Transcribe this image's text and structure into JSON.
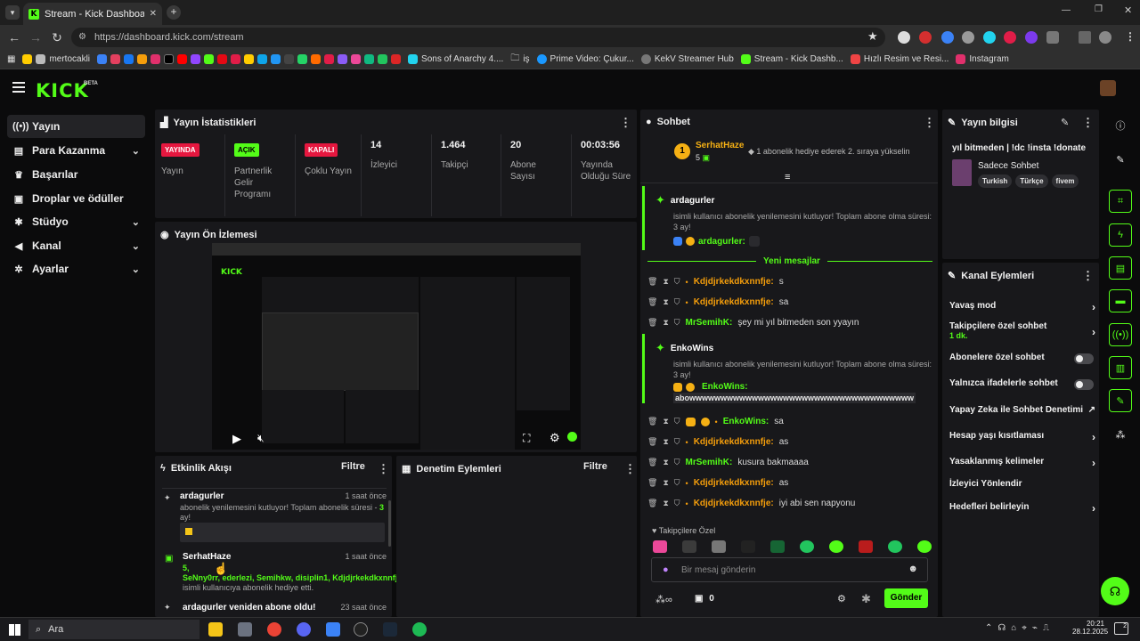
{
  "browser": {
    "tab_title": "Stream - Kick Dashboard",
    "url": "https://dashboard.kick.com/stream",
    "bookmarks": [
      "mertocakli",
      "Sons of Anarchy 4....",
      "iş",
      "Prime Video: Çukur...",
      "KekV Streamer Hub",
      "Stream - Kick Dashb...",
      "Hızlı Resim ve Resi...",
      "Instagram"
    ]
  },
  "header": {
    "logo": "KICK",
    "beta": "BETA"
  },
  "sidebar": {
    "items": [
      {
        "label": "Yayın",
        "icon": "live-icon"
      },
      {
        "label": "Para Kazanma",
        "icon": "money-icon"
      },
      {
        "label": "Başarılar",
        "icon": "trophy-icon"
      },
      {
        "label": "Droplar ve ödüller",
        "icon": "gift-icon"
      },
      {
        "label": "Stüdyo",
        "icon": "gear-icon"
      },
      {
        "label": "Kanal",
        "icon": "megaphone-icon"
      },
      {
        "label": "Ayarlar",
        "icon": "settings-icon"
      }
    ]
  },
  "stats": {
    "title": "Yayın İstatistikleri",
    "cols": [
      {
        "badge": "YAYINDA",
        "label": "Yayın"
      },
      {
        "badge": "AÇIK",
        "label": "Partnerlik Gelir Programı"
      },
      {
        "badge": "KAPALI",
        "label": "Çoklu Yayın"
      },
      {
        "value": "14",
        "label": "İzleyici"
      },
      {
        "value": "1.464",
        "label": "Takipçi"
      },
      {
        "value": "20",
        "label": "Abone Sayısı"
      },
      {
        "value": "00:03:56",
        "label": "Yayında Olduğu Süre"
      }
    ]
  },
  "preview": {
    "title": "Yayın Ön İzlemesi"
  },
  "activity": {
    "title": "Etkinlik Akışı",
    "filter": "Filtre",
    "items": [
      {
        "user": "ardagurler",
        "time": "1 saat önce",
        "text": "abonelik yenilemesini kutluyor! Toplam abonelik süresi -",
        "num": "3",
        "extra": "ay!"
      },
      {
        "user": "SerhatHaze",
        "time": "1 saat önce",
        "count": "5,",
        "names": "SeNny0rr, ederlezi, Semihkw, disiplin1, Kdjdjrkekdkxnnfje",
        "text": "isimli kullanıcıya abonelik hediye etti."
      },
      {
        "user": "ardagurler veniden abone oldu!",
        "time": "23 saat önce"
      }
    ]
  },
  "moderation": {
    "title": "Denetim Eylemleri",
    "filter": "Filtre"
  },
  "chat": {
    "title": "Sohbet",
    "top_user": "SerhatHaze",
    "top_count": "5",
    "top_rank": "1",
    "top_msg": "1 abonelik hediye ederek 2. sıraya yükselin",
    "new_messages": "Yeni mesajlar",
    "sub1": {
      "user": "ardagurler",
      "text": "isimli kullanıcı abonelik yenilemesini kutluyor! Toplam abone olma süresi: 3 ay!",
      "msg_user": "ardagurler:"
    },
    "sub2": {
      "user": "EnkoWins",
      "text": "isimli kullanıcı abonelik yenilemesini kutluyor! Toplam abone olma süresi: 3 ay!",
      "msg_user": "EnkoWins:",
      "msg": "abowwwwwwwwwwwwwwwwwwwwwwwwwwwwwwwwwwww"
    },
    "messages": [
      {
        "user": "Kdjdjrkekdkxnnfje:",
        "text": "s",
        "color": "o"
      },
      {
        "user": "Kdjdjrkekdkxnnfje:",
        "text": "sa",
        "color": "o"
      },
      {
        "user": "MrSemihK:",
        "text": "şey mi yıl bitmeden son yyayın",
        "color": "g"
      },
      {
        "user": "EnkoWins:",
        "text": "sa",
        "color": "g"
      },
      {
        "user": "Kdjdjrkekdkxnnfje:",
        "text": "as",
        "color": "o"
      },
      {
        "user": "MrSemihK:",
        "text": "kusura bakmaaaa",
        "color": "g"
      },
      {
        "user": "Kdjdjrkekdkxnnfje:",
        "text": "as",
        "color": "o"
      },
      {
        "user": "Kdjdjrkekdkxnnfje:",
        "text": "iyi abi sen napyonu",
        "color": "o"
      }
    ],
    "followers_only": "Takipçilere Özel",
    "input_placeholder": "Bir mesaj gönderin",
    "points": "0",
    "send": "Gönder"
  },
  "stream_info": {
    "title": "Yayın bilgisi",
    "stream_title": "yıl bitmeden | !dc !insta !donate",
    "category": "Sadece Sohbet",
    "tags": [
      "Turkish",
      "Türkçe",
      "fivem"
    ]
  },
  "channel_actions": {
    "title": "Kanal Eylemleri",
    "items": [
      {
        "label": "Yavaş mod",
        "type": "chevron"
      },
      {
        "label": "Takipçilere özel sohbet",
        "sub": "1 dk.",
        "type": "chevron"
      },
      {
        "label": "Abonelere özel sohbet",
        "type": "toggle"
      },
      {
        "label": "Yalnızca ifadelerle sohbet",
        "type": "toggle"
      },
      {
        "label": "Yapay Zeka ile Sohbet Denetimi",
        "type": "external"
      },
      {
        "label": "Hesap yaşı kısıtlaması",
        "type": "chevron"
      },
      {
        "label": "Yasaklanmış kelimeler",
        "type": "chevron"
      },
      {
        "label": "İzleyici Yönlendir",
        "type": "none"
      },
      {
        "label": "Hedefleri belirleyin",
        "type": "chevron"
      }
    ]
  },
  "taskbar": {
    "search": "Ara",
    "time": "20:21",
    "date": "28.12.2025",
    "notif": "2"
  }
}
